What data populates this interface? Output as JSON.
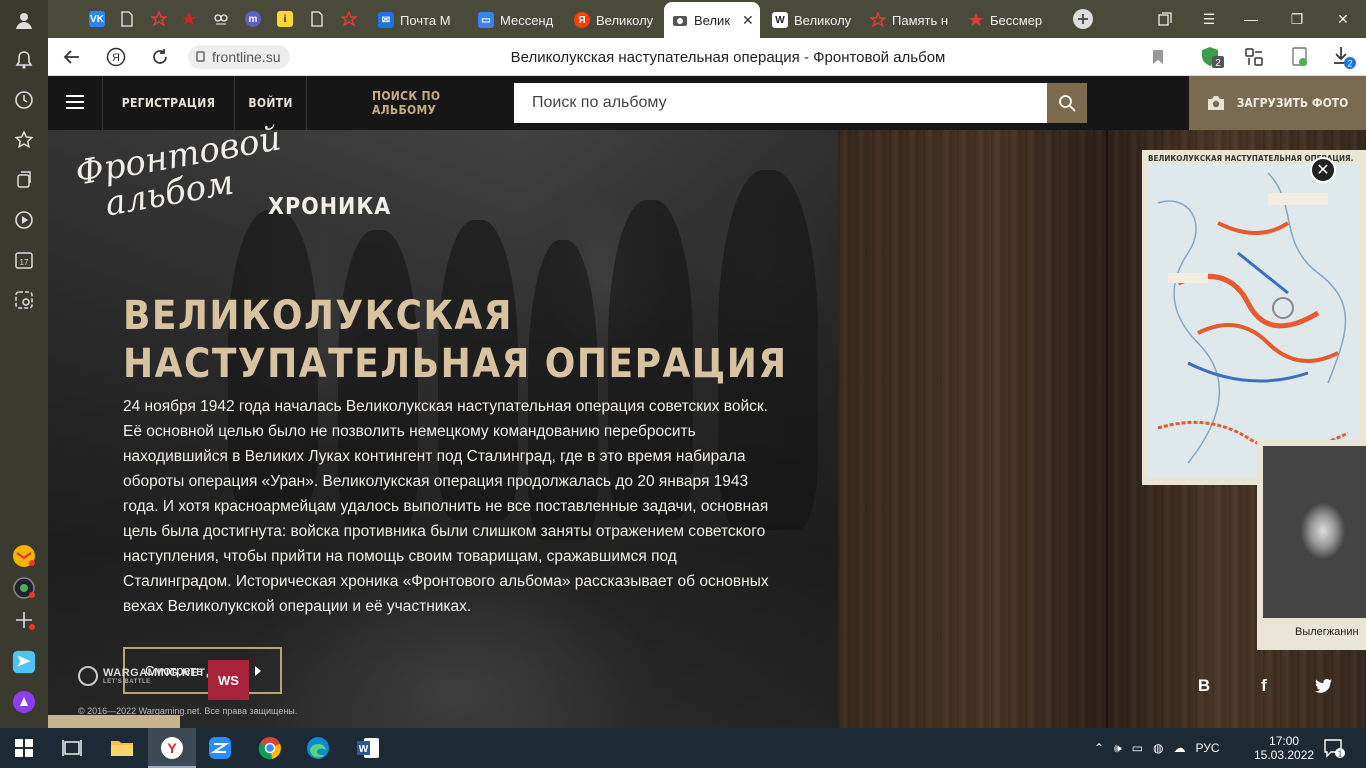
{
  "browser": {
    "tabs": [
      {
        "label": "Почта M",
        "fav": "M",
        "color": "#1a73e8"
      },
      {
        "label": "Мессенд",
        "fav": "✉",
        "color": "#3b82f6"
      },
      {
        "label": "Великолу",
        "fav": "Я",
        "color": "#ff3d00"
      },
      {
        "label": "Велик",
        "fav": "◉",
        "color": "#666666",
        "active": true
      },
      {
        "label": "Великолу",
        "fav": "W",
        "color": "#333333"
      },
      {
        "label": "Память н",
        "fav": "☆",
        "color": "#c62828"
      },
      {
        "label": "Бессмер",
        "fav": "★",
        "color": "#c62828"
      }
    ],
    "address": {
      "domain": "frontline.su",
      "page_title": "Великолукская наступательная операция - Фронтовой альбом"
    },
    "badges": {
      "shield": "2",
      "downloads": "2"
    }
  },
  "site": {
    "nav": {
      "register": "РЕГИСТРАЦИЯ",
      "login": "ВОЙТИ",
      "album_search": "ПОИСК ПО АЛЬБОМУ",
      "search_placeholder": "Поиск по альбому",
      "upload": "ЗАГРУЗИТЬ ФОТО"
    },
    "logo_line1": "Фронтовой",
    "logo_line2": "альбом",
    "chronicle": "ХРОНИКА",
    "heading_line1": "ВЕЛИКОЛУКСКАЯ",
    "heading_line2": "НАСТУПАТЕЛЬНАЯ ОПЕРАЦИЯ",
    "description": "24 ноября 1942 года началась Великолукская наступательная операция советских войск. Её основной целью было не позволить немецкому командованию перебросить находившийся в Великих Луках контингент под Сталинград, где в это время набирала обороты операция «Уран». Великолукская операция продолжалась до 20 января 1943 года. И хотя красноармейцам удалось выполнить не все поставленные задачи, основная цель была достигнута: войска противника были слишком заняты отражением советского наступления, чтобы прийти на помощь своим товарищам, сражавшимся под Сталинградом. Историческая хроника «Фронтового альбома» рассказывает об основных вехах Великолукской операции и её участниках.",
    "more_button": "Смотреть далее",
    "wargaming": "WARGAMING.NET",
    "wargaming_sub": "LET'S BATTLE",
    "ws_badge": "WS",
    "copyright": "© 2016—2022 Wargaming.net. Все права защищены.",
    "map_title": "ВЕЛИКОЛУКСКАЯ НАСТУПАТЕЛЬНАЯ ОПЕРАЦИЯ.",
    "photo_name": "Вылегжанин",
    "social": {
      "vk": "В",
      "fb": "f",
      "tw": "t"
    }
  },
  "taskbar": {
    "lang": "РУС",
    "time": "17:00",
    "date": "15.03.2022",
    "notif": "1"
  }
}
